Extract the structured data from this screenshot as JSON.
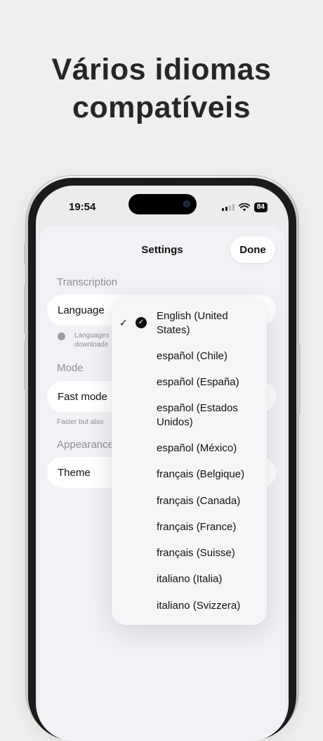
{
  "headline": {
    "line1": "Vários idiomas",
    "line2": "compatíveis"
  },
  "status_bar": {
    "time": "19:54",
    "battery": "84"
  },
  "sheet": {
    "title": "Settings",
    "done_label": "Done",
    "sections": {
      "transcription": "Transcription",
      "mode": "Mode",
      "appearance": "Appearance"
    },
    "rows": {
      "language": "Language",
      "fast_mode": "Fast mode",
      "theme": "Theme"
    },
    "notes": {
      "language_line1": "Languages",
      "language_line2": "downloade",
      "fast_mode": "Faster but also"
    }
  },
  "language_menu": {
    "selected": "English (United States)",
    "options": [
      "English (United States)",
      "español (Chile)",
      "español (España)",
      "español (Estados Unidos)",
      "español (México)",
      "français (Belgique)",
      "français (Canada)",
      "français (France)",
      "français (Suisse)",
      "italiano (Italia)",
      "italiano (Svizzera)"
    ]
  },
  "icons": {
    "check": "checkmark-icon",
    "selected": "checkmark-circle-icon",
    "info": "info-dot-icon",
    "wifi": "wifi-icon",
    "signal": "cellular-signal-icon",
    "battery": "battery-icon"
  }
}
